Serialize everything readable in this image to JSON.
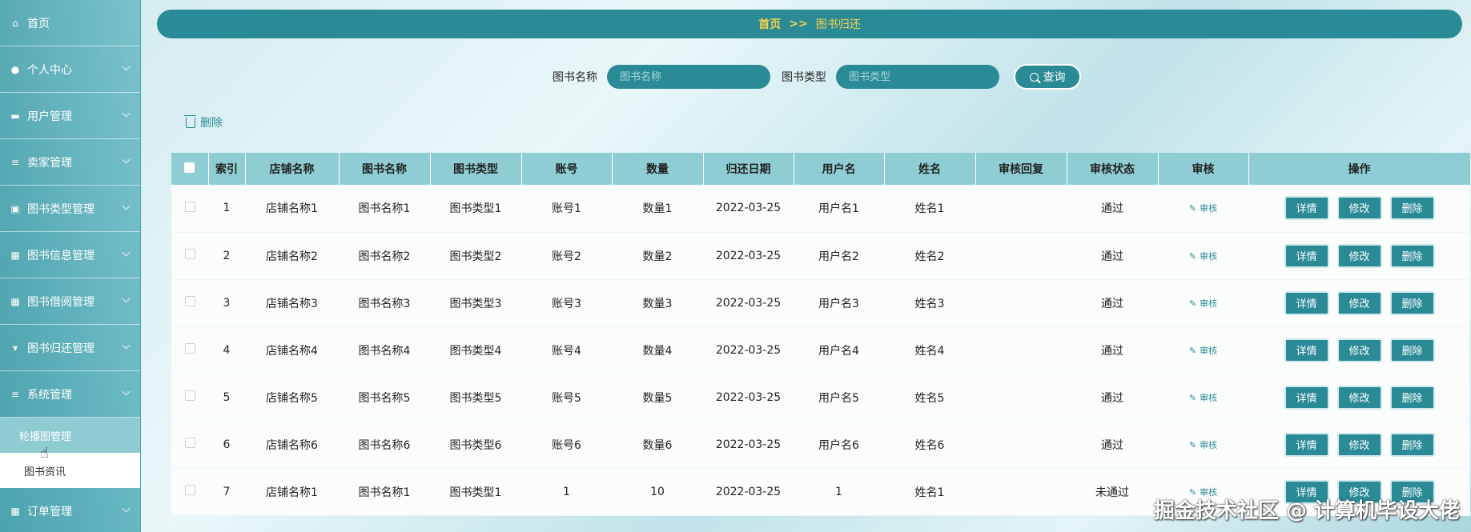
{
  "sidebar": {
    "items": [
      {
        "label": "首页",
        "icon": "home-icon",
        "glyph": "⌂",
        "chevron": false
      },
      {
        "label": "个人中心",
        "icon": "user-icon",
        "glyph": "●",
        "chevron": true
      },
      {
        "label": "用户管理",
        "icon": "monitor-icon",
        "glyph": "▬",
        "chevron": true
      },
      {
        "label": "卖家管理",
        "icon": "list-icon",
        "glyph": "≡",
        "chevron": true
      },
      {
        "label": "图书类型管理",
        "icon": "clipboard-icon",
        "glyph": "▣",
        "chevron": true
      },
      {
        "label": "图书信息管理",
        "icon": "grid-icon",
        "glyph": "▦",
        "chevron": true
      },
      {
        "label": "图书借阅管理",
        "icon": "grid-icon",
        "glyph": "▦",
        "chevron": true
      },
      {
        "label": "图书归还管理",
        "icon": "pin-icon",
        "glyph": "▾",
        "chevron": true
      },
      {
        "label": "系统管理",
        "icon": "list-icon",
        "glyph": "≡",
        "chevron": true
      }
    ],
    "submenu": [
      {
        "label": "轮播图管理",
        "active": true
      },
      {
        "label": "图书资讯",
        "active": false
      }
    ],
    "last_item": {
      "label": "订单管理",
      "icon": "grid-icon",
      "glyph": "▦"
    }
  },
  "breadcrumb": {
    "home": "首页",
    "separator": ">>",
    "current": "图书归还"
  },
  "search": {
    "name_label": "图书名称",
    "name_placeholder": "图书名称",
    "type_label": "图书类型",
    "type_placeholder": "图书类型",
    "query_label": "查询"
  },
  "toolbar": {
    "delete_label": "删除"
  },
  "table": {
    "columns": [
      "索引",
      "店铺名称",
      "图书名称",
      "图书类型",
      "账号",
      "数量",
      "归还日期",
      "用户名",
      "姓名",
      "审核回复",
      "审核状态",
      "审核",
      "操作"
    ],
    "audit_label": "审核",
    "actions": {
      "detail": "详情",
      "edit": "修改",
      "delete": "删除"
    },
    "rows": [
      {
        "index": "1",
        "shop": "店铺名称1",
        "book": "图书名称1",
        "type": "图书类型1",
        "account": "账号1",
        "qty": "数量1",
        "date": "2022-03-25",
        "username": "用户名1",
        "name": "姓名1",
        "reply": "",
        "status": "通过"
      },
      {
        "index": "2",
        "shop": "店铺名称2",
        "book": "图书名称2",
        "type": "图书类型2",
        "account": "账号2",
        "qty": "数量2",
        "date": "2022-03-25",
        "username": "用户名2",
        "name": "姓名2",
        "reply": "",
        "status": "通过"
      },
      {
        "index": "3",
        "shop": "店铺名称3",
        "book": "图书名称3",
        "type": "图书类型3",
        "account": "账号3",
        "qty": "数量3",
        "date": "2022-03-25",
        "username": "用户名3",
        "name": "姓名3",
        "reply": "",
        "status": "通过"
      },
      {
        "index": "4",
        "shop": "店铺名称4",
        "book": "图书名称4",
        "type": "图书类型4",
        "account": "账号4",
        "qty": "数量4",
        "date": "2022-03-25",
        "username": "用户名4",
        "name": "姓名4",
        "reply": "",
        "status": "通过"
      },
      {
        "index": "5",
        "shop": "店铺名称5",
        "book": "图书名称5",
        "type": "图书类型5",
        "account": "账号5",
        "qty": "数量5",
        "date": "2022-03-25",
        "username": "用户名5",
        "name": "姓名5",
        "reply": "",
        "status": "通过"
      },
      {
        "index": "6",
        "shop": "店铺名称6",
        "book": "图书名称6",
        "type": "图书类型6",
        "account": "账号6",
        "qty": "数量6",
        "date": "2022-03-25",
        "username": "用户名6",
        "name": "姓名6",
        "reply": "",
        "status": "通过"
      },
      {
        "index": "7",
        "shop": "店铺名称1",
        "book": "图书名称1",
        "type": "图书类型1",
        "account": "1",
        "qty": "10",
        "date": "2022-03-25",
        "username": "1",
        "name": "姓名1",
        "reply": "",
        "status": "未通过"
      }
    ]
  },
  "watermark": "掘金技术社区 @ 计算机毕设大佬"
}
